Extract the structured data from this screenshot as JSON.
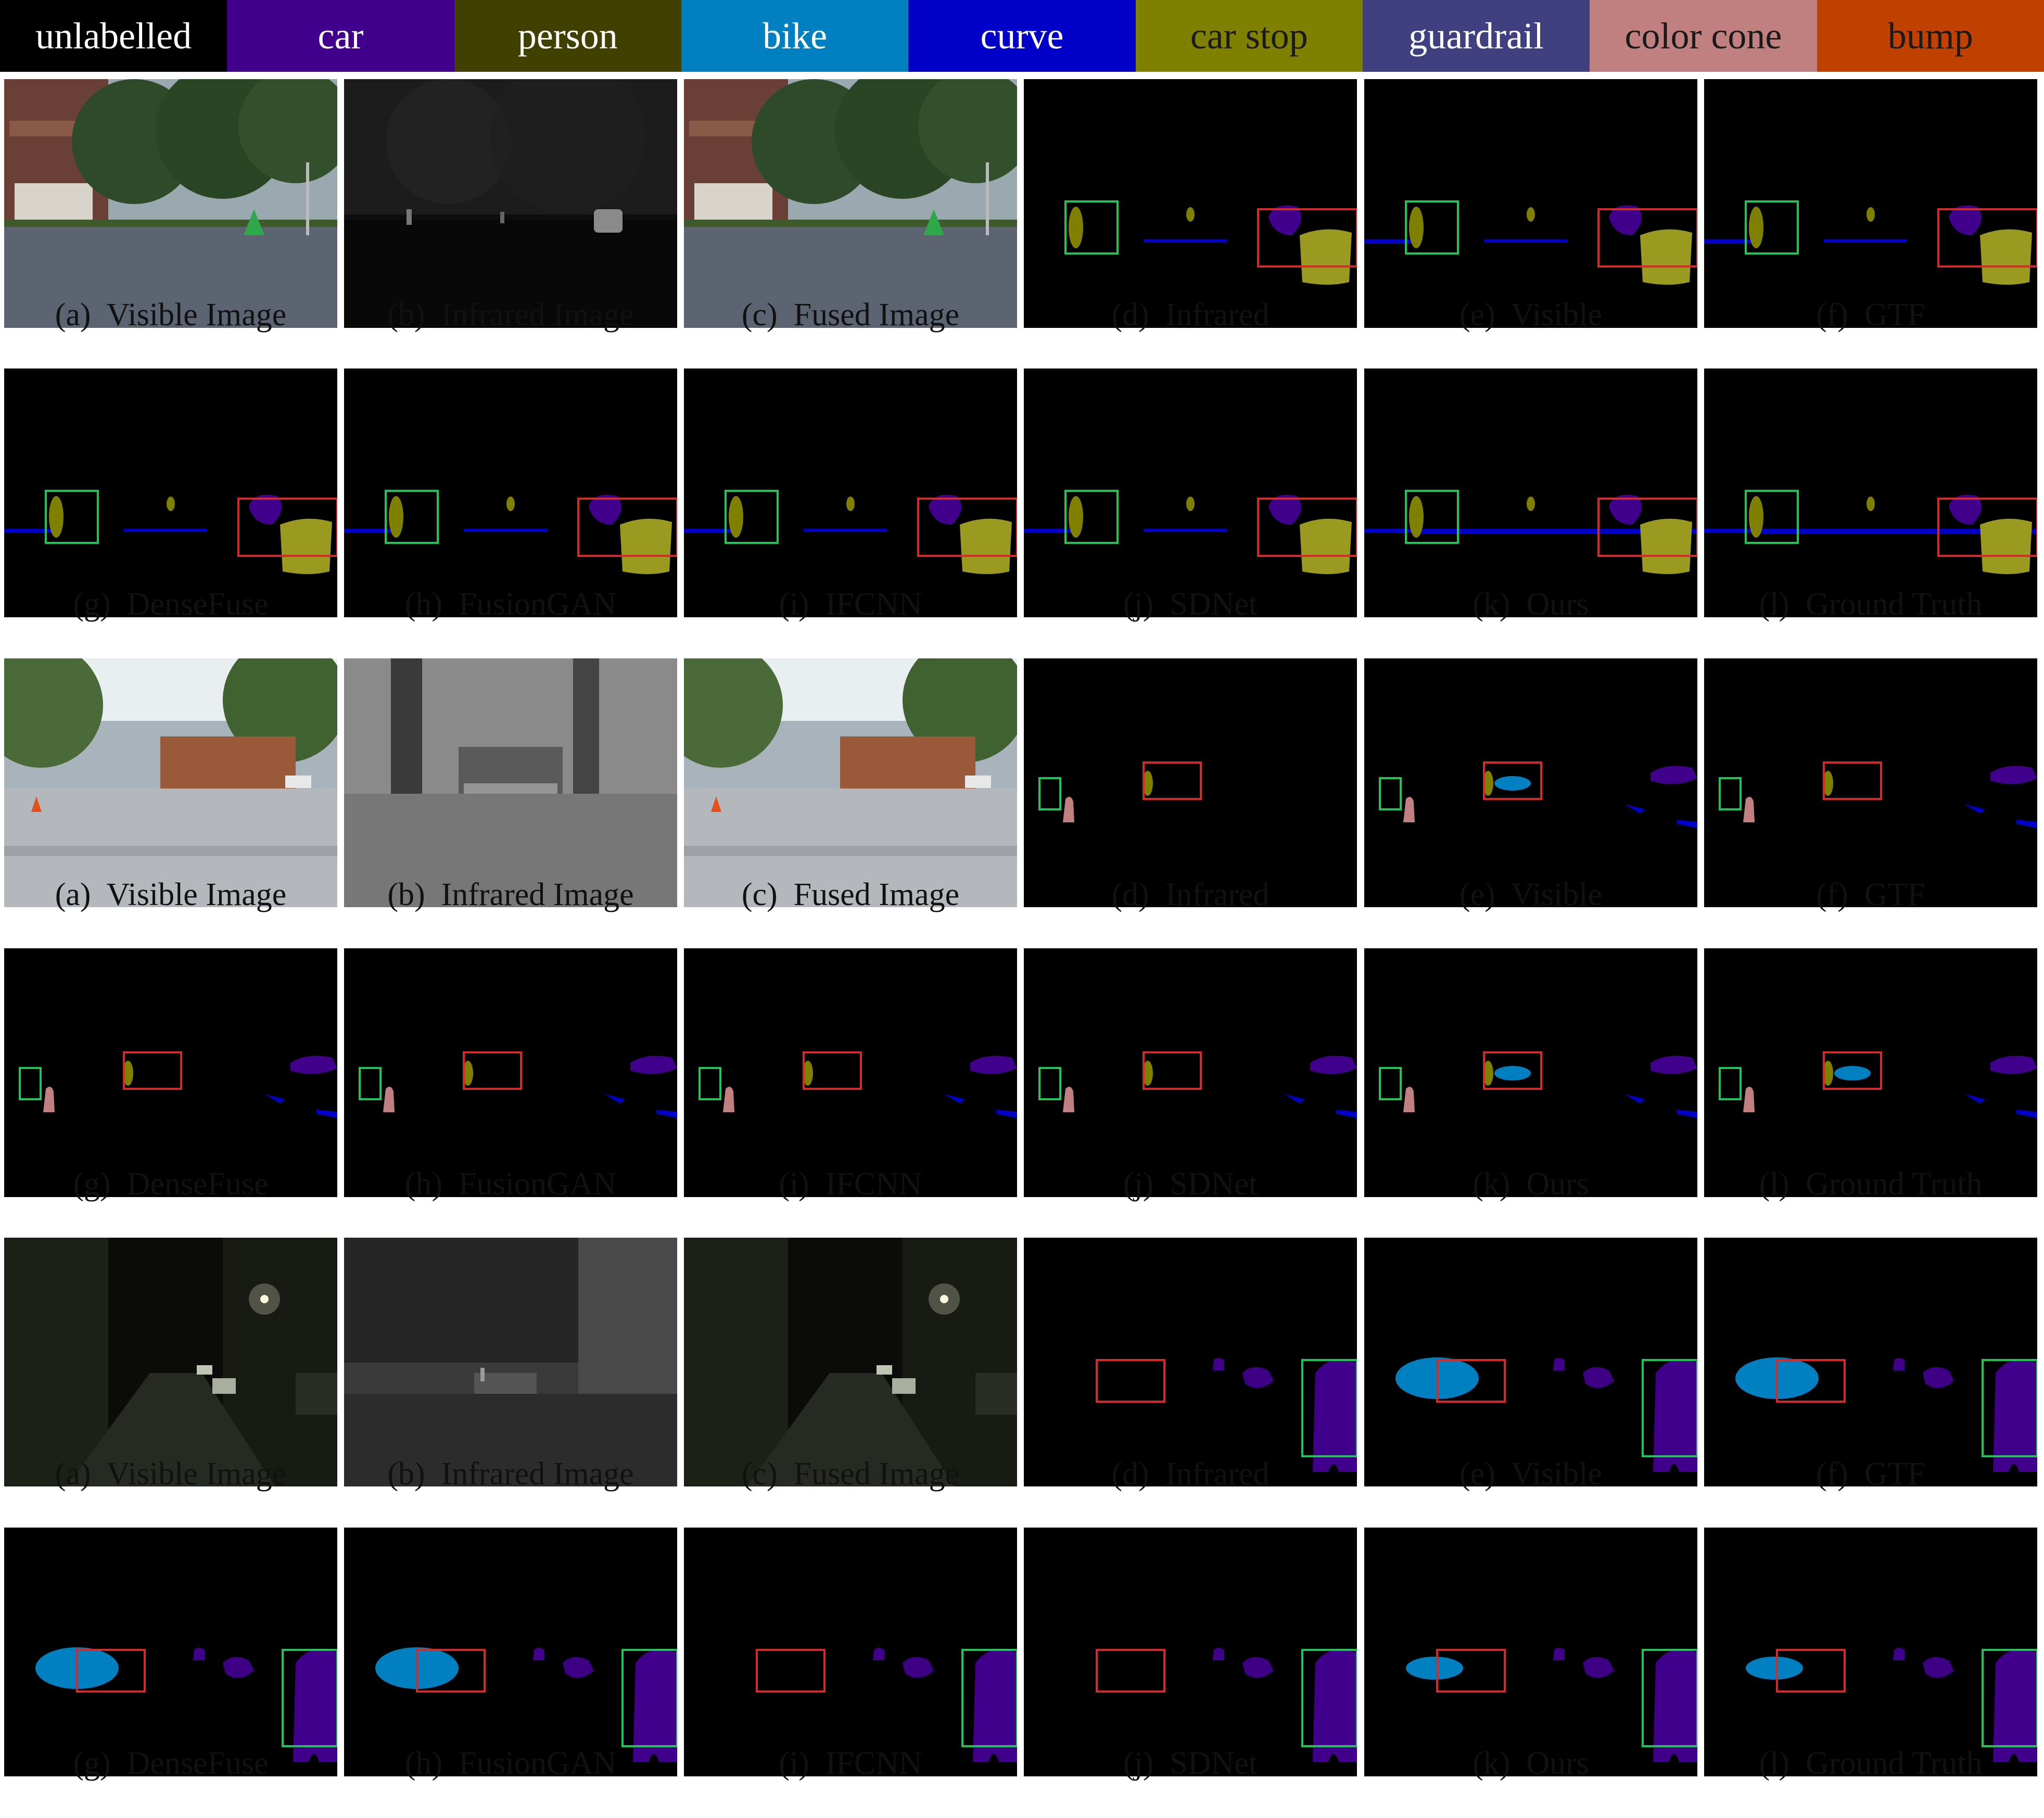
{
  "legend": [
    {
      "label": "unlabelled",
      "color": "#000000"
    },
    {
      "label": "car",
      "color": "#40008c"
    },
    {
      "label": "person",
      "color": "#404000"
    },
    {
      "label": "bike",
      "color": "#0080c0"
    },
    {
      "label": "curve",
      "color": "#0000c8"
    },
    {
      "label": "car stop",
      "color": "#808000"
    },
    {
      "label": "guardrail",
      "color": "#404080"
    },
    {
      "label": "color cone",
      "color": "#c08080"
    },
    {
      "label": "bump",
      "color": "#c04000"
    }
  ],
  "rows": [
    {
      "captions": [
        "(a)  Visible Image",
        "(b)  Infrared Image",
        "(c)  Fused Image",
        "(d)  Infrared",
        "(e)  Visible",
        "(f)  GTF"
      ]
    },
    {
      "captions": [
        "(g)  DenseFuse",
        "(h)  FusionGAN",
        "(i)  IFCNN",
        "(j)  SDNet",
        "(k)  Ours",
        "(l)  Ground Truth"
      ]
    },
    {
      "captions": [
        "(a)  Visible Image",
        "(b)  Infrared Image",
        "(c)  Fused Image",
        "(d)  Infrared",
        "(e)  Visible",
        "(f)  GTF"
      ]
    },
    {
      "captions": [
        "(g)  DenseFuse",
        "(h)  FusionGAN",
        "(i)  IFCNN",
        "(j)  SDNet",
        "(k)  Ours",
        "(l)  Ground Truth"
      ]
    },
    {
      "captions": [
        "(a)  Visible Image",
        "(b)  Infrared Image",
        "(c)  Fused Image",
        "(d)  Infrared",
        "(e)  Visible",
        "(f)  GTF"
      ]
    },
    {
      "captions": [
        "(g)  DenseFuse",
        "(h)  FusionGAN",
        "(i)  IFCNN",
        "(j)  SDNet",
        "(k)  Ours",
        "(l)  Ground Truth"
      ]
    }
  ],
  "box_colors": {
    "green": "#22c45a",
    "red": "#d42a2a"
  }
}
